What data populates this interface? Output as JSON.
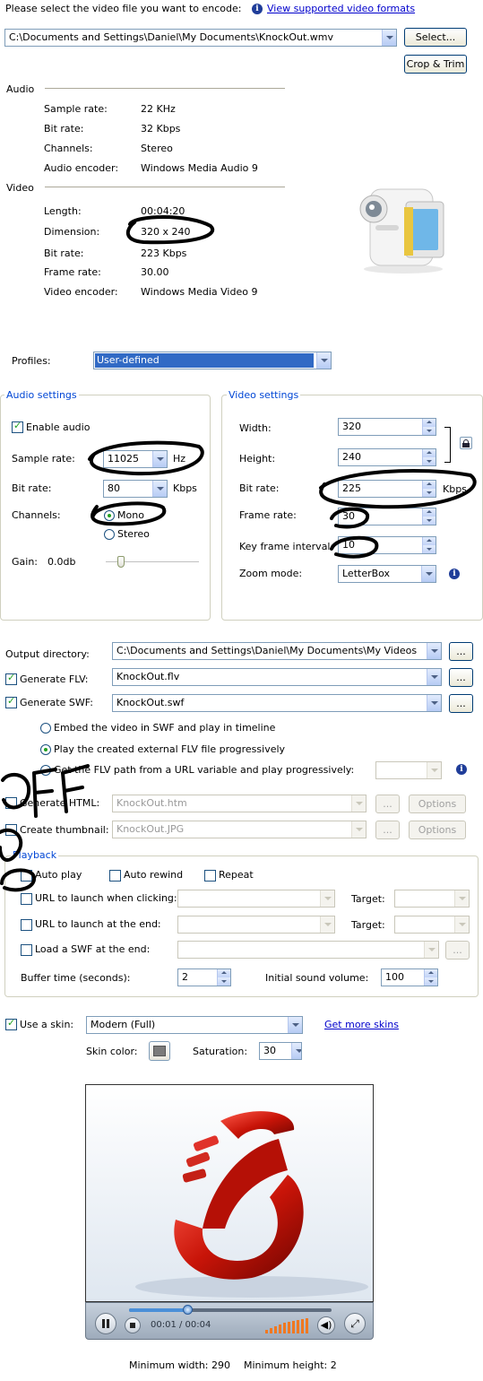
{
  "header": {
    "prompt": "Please select the video file you want to encode:",
    "formats_link": "View supported video formats",
    "file_path": "C:\\Documents and Settings\\Daniel\\My Documents\\KnockOut.wmv",
    "select_button": "Select...",
    "crop_button": "Crop & Trim"
  },
  "audio_info": {
    "heading": "Audio",
    "rows": [
      {
        "label": "Sample rate:",
        "value": "22 KHz"
      },
      {
        "label": "Bit rate:",
        "value": "32 Kbps"
      },
      {
        "label": "Channels:",
        "value": "Stereo"
      },
      {
        "label": "Audio encoder:",
        "value": "Windows Media Audio 9"
      }
    ]
  },
  "video_info": {
    "heading": "Video",
    "rows": [
      {
        "label": "Length:",
        "value": "00:04:20"
      },
      {
        "label": "Dimension:",
        "value": "320 x 240"
      },
      {
        "label": "Bit rate:",
        "value": "223 Kbps"
      },
      {
        "label": "Frame rate:",
        "value": "30.00"
      },
      {
        "label": "Video encoder:",
        "value": "Windows Media Video 9"
      }
    ]
  },
  "profiles": {
    "label": "Profiles:",
    "value": "User-defined"
  },
  "audio_settings": {
    "title": "Audio settings",
    "enable_audio": "Enable audio",
    "sample_rate_label": "Sample rate:",
    "sample_rate_value": "11025",
    "sample_rate_unit": "Hz",
    "bit_rate_label": "Bit rate:",
    "bit_rate_value": "80",
    "bit_rate_unit": "Kbps",
    "channels_label": "Channels:",
    "mono": "Mono",
    "stereo": "Stereo",
    "gain_label": "Gain:",
    "gain_value": "0.0db"
  },
  "video_settings": {
    "title": "Video settings",
    "width_label": "Width:",
    "width_value": "320",
    "height_label": "Height:",
    "height_value": "240",
    "bit_rate_label": "Bit rate:",
    "bit_rate_value": "225",
    "bit_rate_unit": "Kbps",
    "frame_rate_label": "Frame rate:",
    "frame_rate_value": "30",
    "key_frame_label": "Key frame interval:",
    "key_frame_value": "10",
    "zoom_label": "Zoom mode:",
    "zoom_value": "LetterBox"
  },
  "output": {
    "dir_label": "Output directory:",
    "dir_value": "C:\\Documents and Settings\\Daniel\\My Documents\\My Videos",
    "flv_label": "Generate FLV:",
    "flv_value": "KnockOut.flv",
    "swf_label": "Generate SWF:",
    "swf_value": "KnockOut.swf",
    "browse": "...",
    "radio_embed": "Embed the video in SWF and play in timeline",
    "radio_progressive": "Play the created external FLV file progressively",
    "radio_url": "Get the FLV path from a URL variable and play progressively:",
    "html_label": "Generate HTML:",
    "html_value": "KnockOut.htm",
    "thumb_label": "Create thumbnail:",
    "thumb_value": "KnockOut.JPG",
    "options": "Options",
    "scribble_text": "OFF"
  },
  "playback": {
    "title": "Playback",
    "auto_play": "Auto play",
    "auto_rewind": "Auto rewind",
    "repeat": "Repeat",
    "url_click": "URL to launch when clicking:",
    "url_end": "URL to launch at the end:",
    "target": "Target:",
    "load_swf": "Load a SWF at the end:",
    "buffer_label": "Buffer time (seconds):",
    "buffer_value": "2",
    "volume_label": "Initial sound volume:",
    "volume_value": "100"
  },
  "skin": {
    "use_skin": "Use a skin:",
    "skin_value": "Modern (Full)",
    "more_skins": "Get more skins",
    "color_label": "Skin color:",
    "saturation_label": "Saturation:",
    "saturation_value": "30",
    "time": "00:01 / 00:04",
    "min_width": "Minimum width: 290",
    "min_height": "Minimum height: 2"
  },
  "colors": {
    "accent": "#0046d5",
    "profile_highlight": "#316ac5",
    "check": "#21a121",
    "player_bar": "#a8b4c4",
    "volume": "#f07820"
  }
}
